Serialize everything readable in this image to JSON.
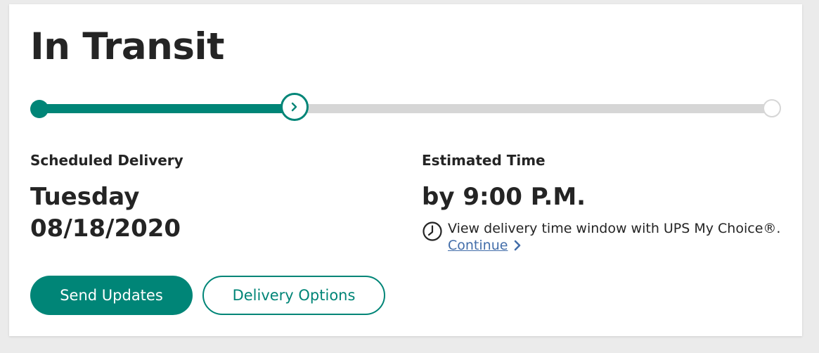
{
  "status": {
    "title": "In Transit",
    "progress_fraction": 0.349
  },
  "delivery": {
    "scheduled_label": "Scheduled Delivery",
    "day": "Tuesday",
    "date": "08/18/2020"
  },
  "estimate": {
    "label": "Estimated Time",
    "time": "by 9:00 P.M.",
    "window_note": "View delivery time window with UPS My Choice®.",
    "continue_label": "Continue"
  },
  "actions": {
    "send_updates_label": "Send Updates",
    "delivery_options_label": "Delivery Options"
  },
  "icons": {
    "current_marker": "chevron-right-icon",
    "clock": "clock-icon",
    "continue": "chevron-right-icon"
  },
  "colors": {
    "accent": "#008577",
    "track": "#d6d6d6",
    "link": "#426da9",
    "text": "#242424"
  }
}
